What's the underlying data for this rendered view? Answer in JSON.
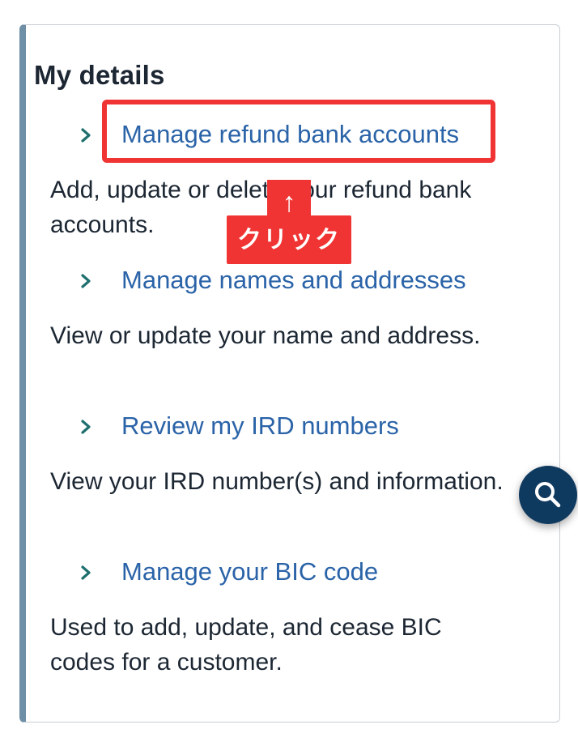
{
  "section": {
    "title": "My details"
  },
  "items": [
    {
      "link": "Manage refund bank accounts",
      "description": "Add, update or delete your refund bank accounts."
    },
    {
      "link": "Manage names and addresses",
      "description": "View or update your name and address."
    },
    {
      "link": "Review my IRD numbers",
      "description": "View your IRD number(s) and information."
    },
    {
      "link": "Manage your BIC code",
      "description": "Used to add, update, and cease BIC codes for a customer."
    }
  ],
  "annotation": {
    "arrow": "↑",
    "label": "クリック",
    "color": "#f03434"
  },
  "icons": {
    "chevron": "chevron-right-icon",
    "search": "search-icon"
  },
  "colors": {
    "link": "#2a63a8",
    "chevron": "#1f6f6f",
    "accent_bar": "#6f8fa6",
    "fab": "#0f3a60"
  }
}
